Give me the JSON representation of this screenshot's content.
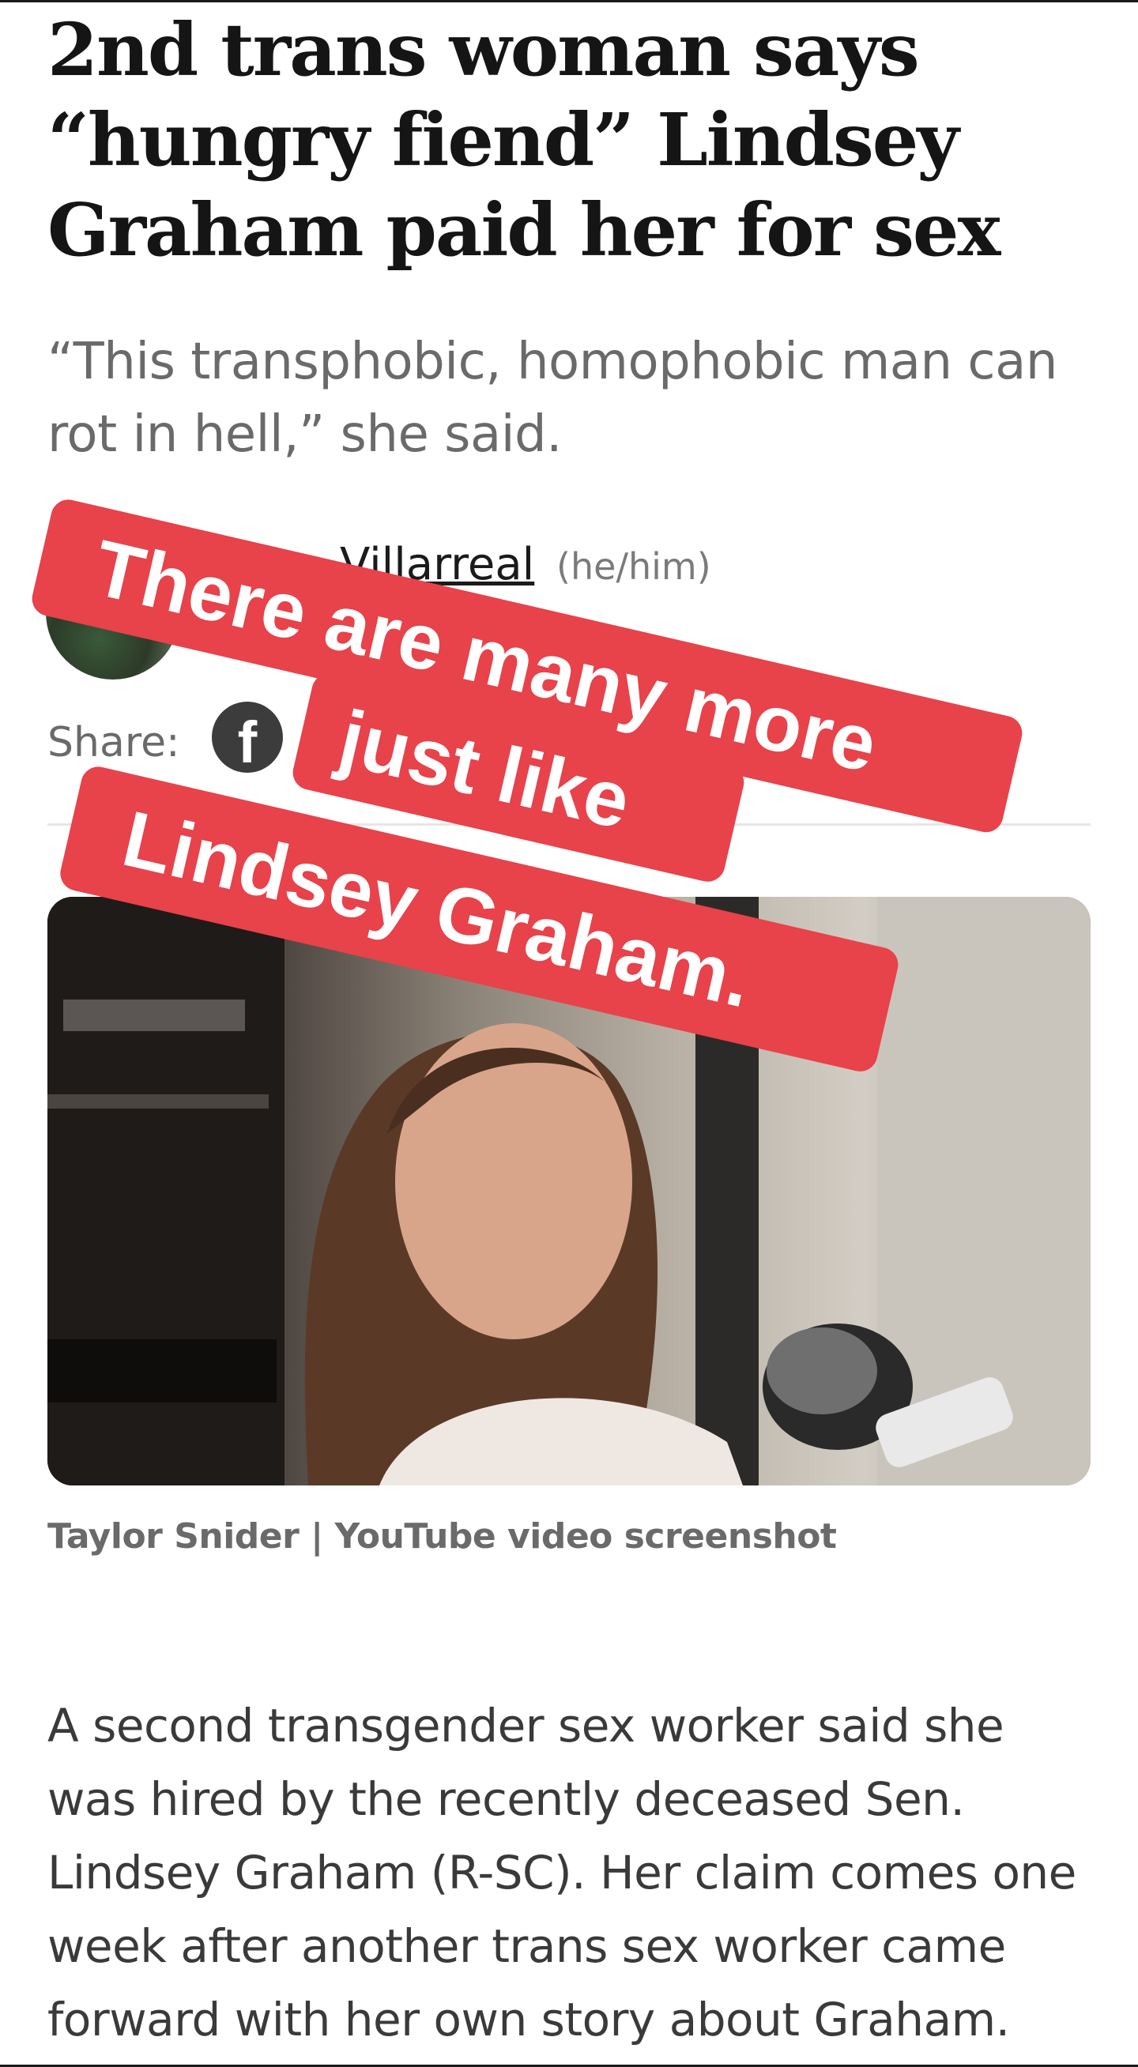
{
  "article": {
    "headline": "2nd trans woman says “hungry fiend” Lindsey Graham paid her for sex",
    "dek": "“This transphobic, homophobic man can rot in hell,” she said.",
    "author_visible_name": "Villarreal",
    "author_pronouns": "(he/him)",
    "share_label": "Share:",
    "share_icons": [
      "facebook-icon"
    ],
    "image_caption": "Taylor Snider | YouTube video screenshot",
    "body_paragraph": "A second transgender sex worker said she was hired by the recently deceased Sen. Lindsey Graham (R-SC). Her claim comes one week after another trans sex worker came forward with her own story about Graham."
  },
  "overlay_sticker": {
    "line_1": "There are many more",
    "line_2": "just like",
    "line_3": "Lindsey Graham.",
    "color": "#e8424a"
  }
}
